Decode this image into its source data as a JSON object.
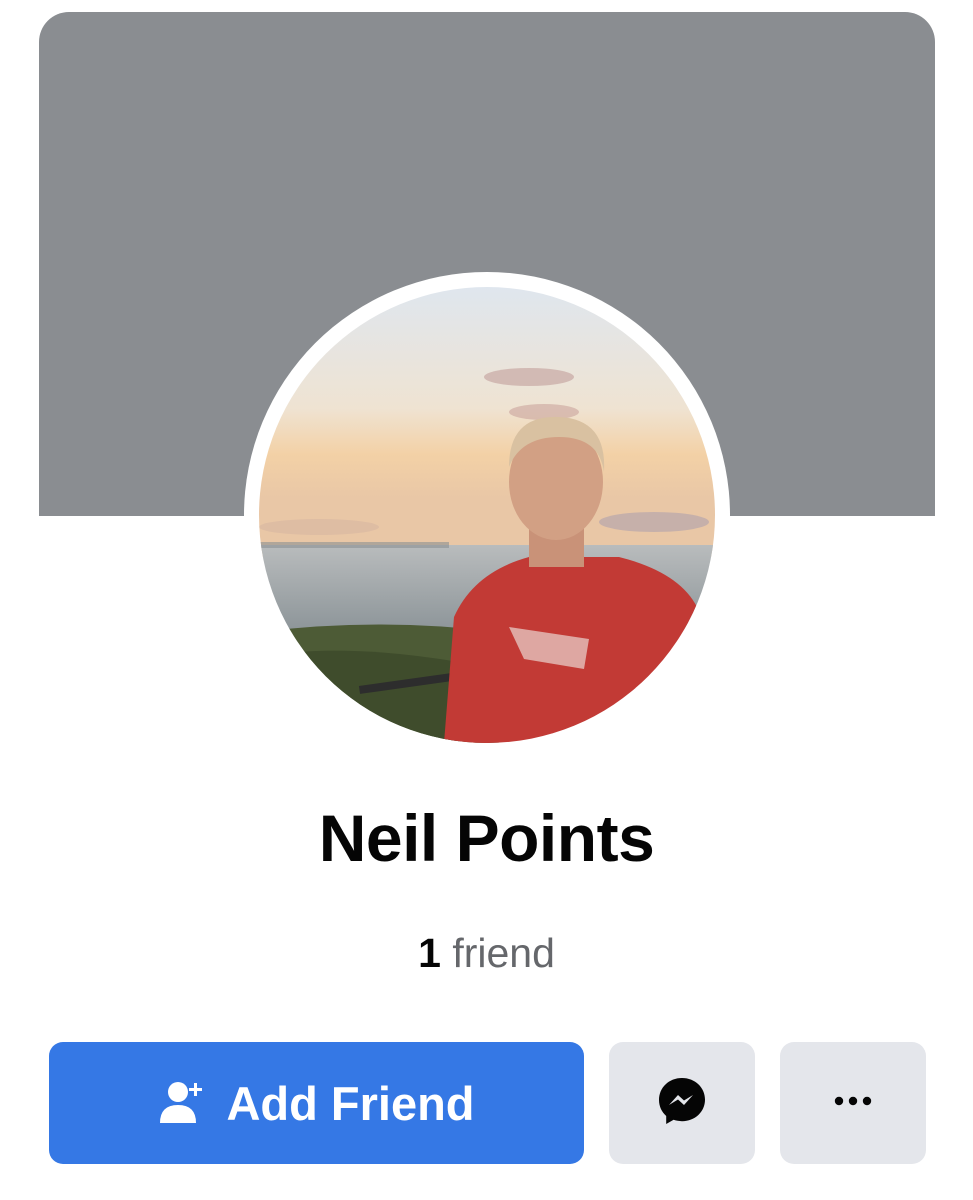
{
  "profile": {
    "name": "Neil Points",
    "friend_count": "1",
    "friend_label": "friend"
  },
  "actions": {
    "add_friend_label": "Add Friend",
    "add_friend_icon": "person-add-icon",
    "message_icon": "messenger-icon",
    "more_icon": "more-dots-icon"
  },
  "colors": {
    "cover": "#8a8d91",
    "primary_button": "#3578e5",
    "secondary_button": "#e4e6eb"
  }
}
